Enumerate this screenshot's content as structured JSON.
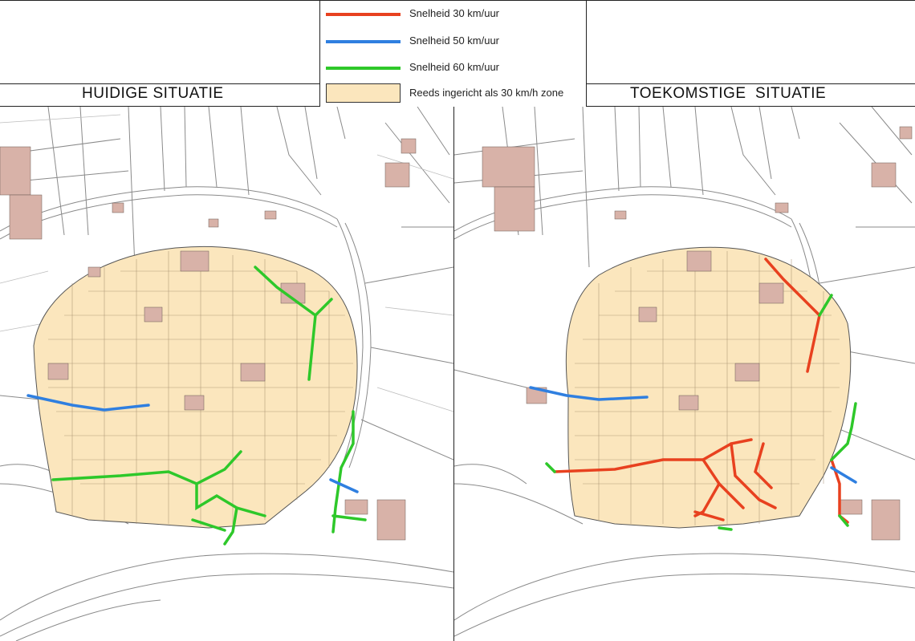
{
  "colors": {
    "speed_30": "#e8411f",
    "speed_50": "#2f7fe0",
    "speed_60": "#2ec82a",
    "zone_30_fill": "#fbe6bd",
    "zone_30_border": "#555555",
    "building_fill": "#d8b2a8",
    "road_line": "#8a8a8a",
    "background": "#ffffff"
  },
  "legend": {
    "items": [
      {
        "label": "Snelheid 30 km/uur",
        "type": "line",
        "color_key": "speed_30"
      },
      {
        "label": "Snelheid 50 km/uur",
        "type": "line",
        "color_key": "speed_50"
      },
      {
        "label": "Snelheid 60 km/uur",
        "type": "line",
        "color_key": "speed_60"
      },
      {
        "label": "Reeds ingericht als 30 km/h zone",
        "type": "area",
        "color_key": "zone_30_fill"
      }
    ]
  },
  "panels": {
    "left": {
      "title": "HUIDIGE SITUATIE"
    },
    "right": {
      "title": "TOEKOMSTIGE  SITUATIE"
    }
  }
}
